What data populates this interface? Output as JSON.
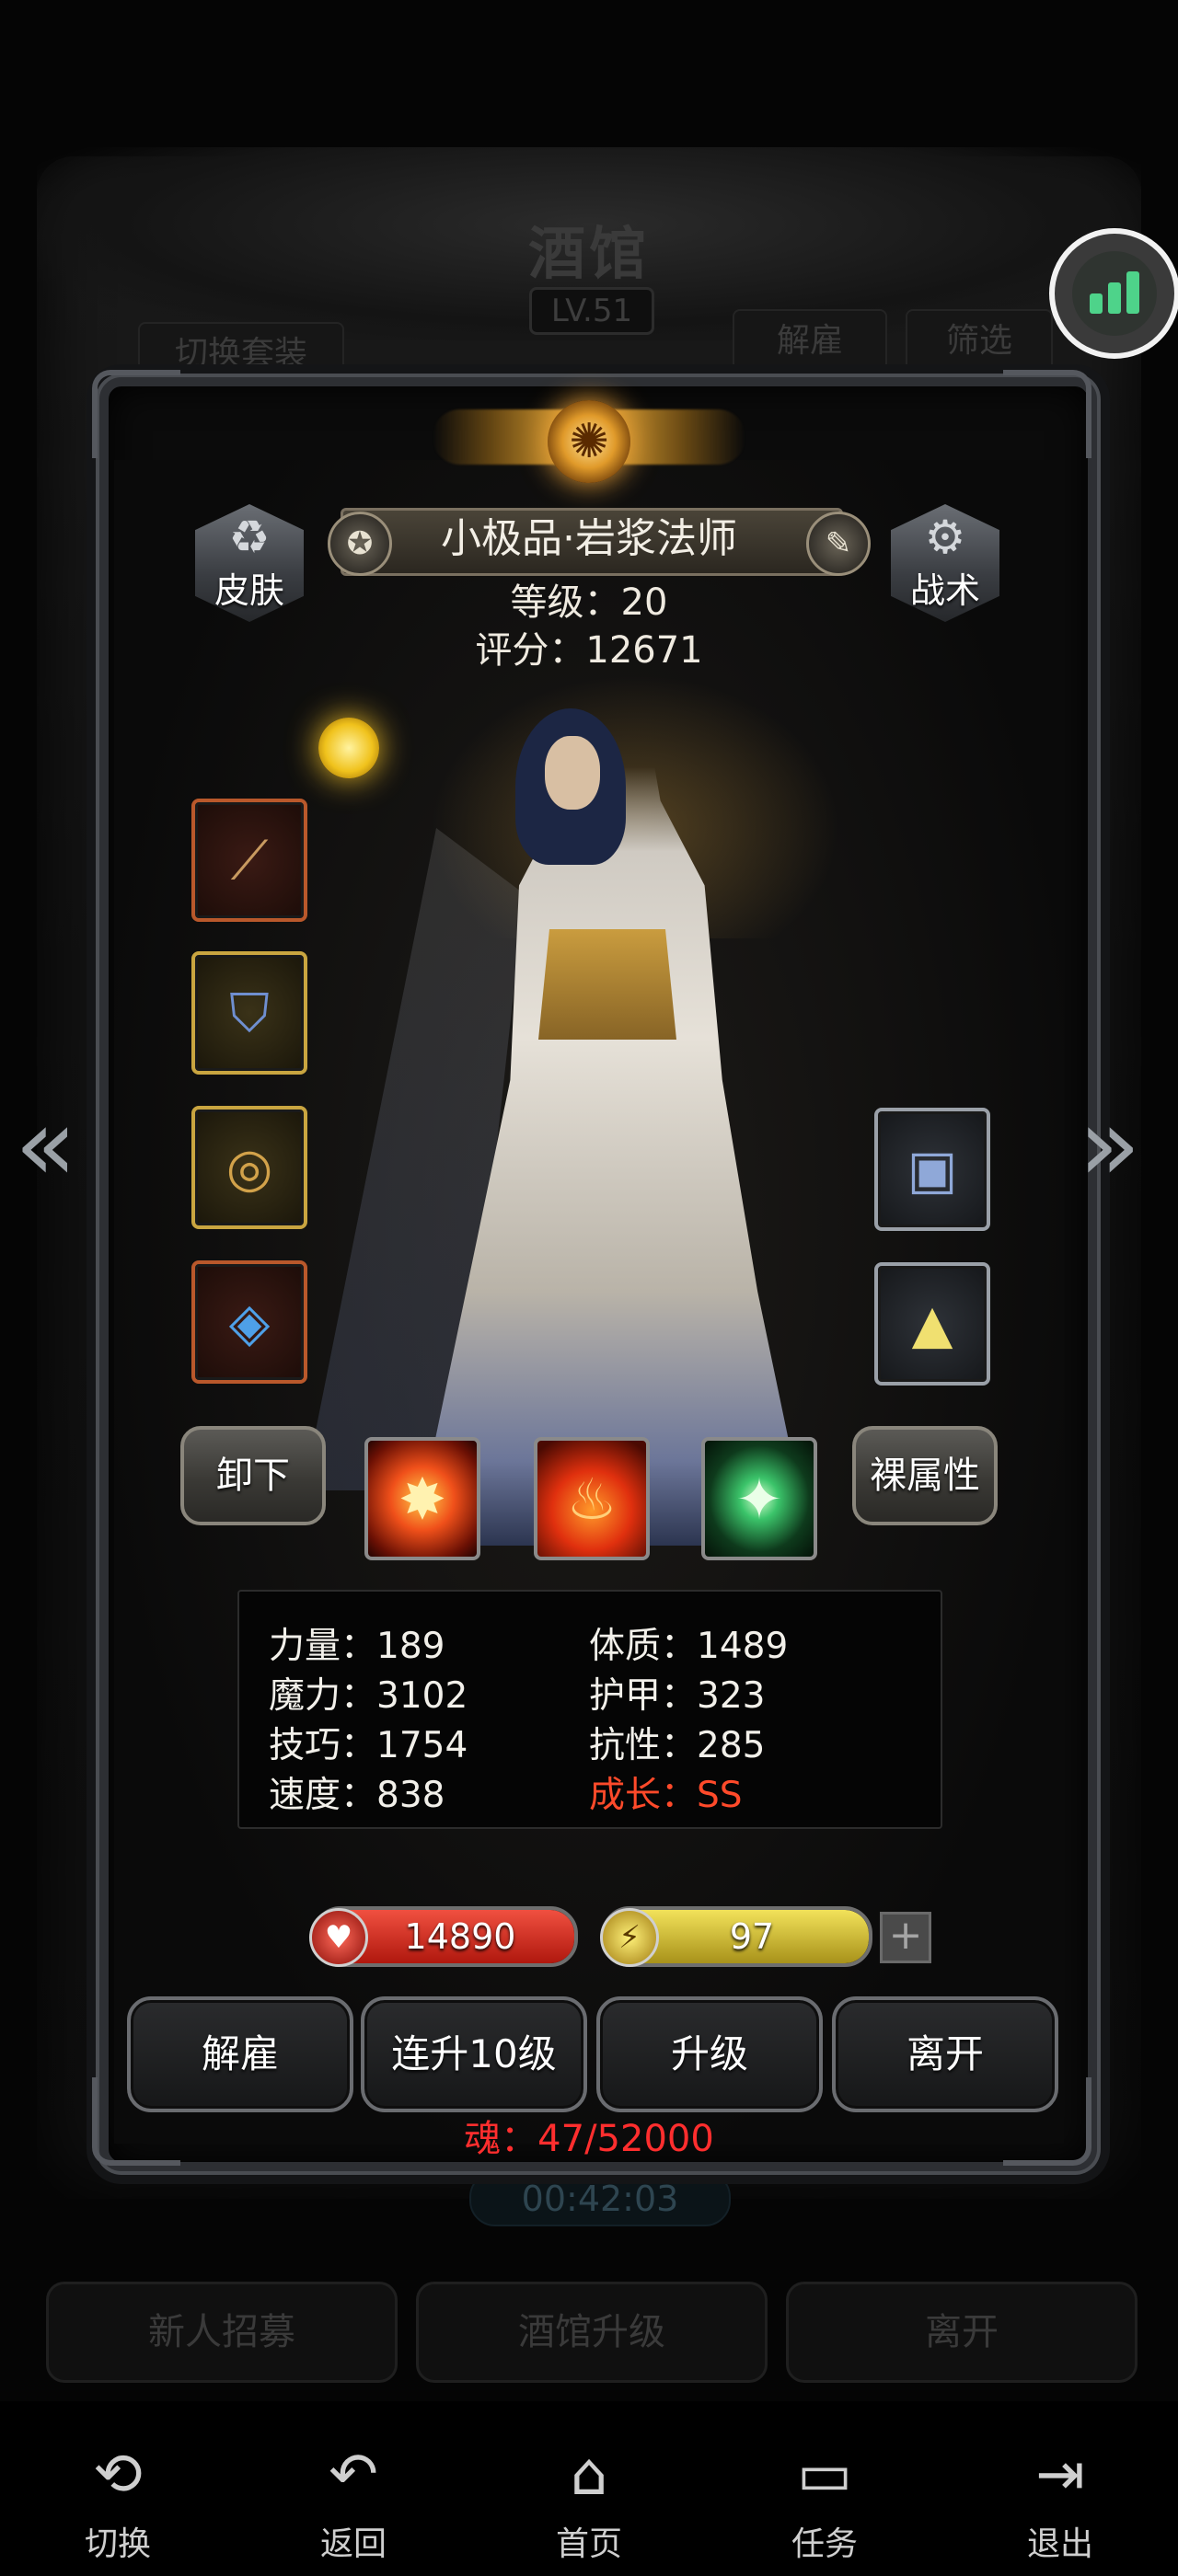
{
  "background": {
    "title": "酒馆",
    "level": "LV.51",
    "tabs": [
      "切换套装",
      "解雇",
      "筛选"
    ],
    "timer": "00:42:03",
    "buttons": [
      "新人招募",
      "酒馆升级",
      "离开"
    ]
  },
  "hero": {
    "name": "小极品·岩浆法师",
    "level_text": "等级：20",
    "score_text": "评分：12671",
    "skin_label": "皮肤",
    "tactics_label": "战术",
    "unequip_label": "卸下",
    "naked_attr_label": "裸属性"
  },
  "equipment_left": [
    {
      "icon": "staff-icon",
      "glyph": "⟋",
      "frame": "red"
    },
    {
      "icon": "robe-icon",
      "glyph": "⛉",
      "frame": "gold"
    },
    {
      "icon": "ring-icon",
      "glyph": "◎",
      "frame": "gold"
    },
    {
      "icon": "amulet-icon",
      "glyph": "◈",
      "frame": "red"
    }
  ],
  "equipment_right": [
    {
      "icon": "card-icon",
      "glyph": "▣",
      "frame": "gray"
    },
    {
      "icon": "crystal-icon",
      "glyph": "▲",
      "frame": "gray"
    }
  ],
  "skills": [
    {
      "icon": "fire-burst-icon",
      "glyph": "✸"
    },
    {
      "icon": "flame-icon",
      "glyph": "♨"
    },
    {
      "icon": "green-blade-icon",
      "glyph": "✦"
    }
  ],
  "stats": {
    "left": [
      "力量：189",
      "魔力：3102",
      "技巧：1754",
      "速度：838"
    ],
    "right": [
      "体质：1489",
      "护甲：323",
      "抗性：285",
      "成长：SS"
    ]
  },
  "bars": {
    "hp": "14890",
    "energy": "97",
    "energy_plus": "+"
  },
  "actions": [
    "解雇",
    "连升10级",
    "升级",
    "离开"
  ],
  "soul": "魂：47/52000",
  "nav": [
    {
      "label": "切换",
      "icon": "switch-icon",
      "glyph": "⟲"
    },
    {
      "label": "返回",
      "icon": "back-icon",
      "glyph": "↶"
    },
    {
      "label": "首页",
      "icon": "home-icon",
      "glyph": "⌂"
    },
    {
      "label": "任务",
      "icon": "tasks-icon",
      "glyph": "▭"
    },
    {
      "label": "退出",
      "icon": "exit-icon",
      "glyph": "⇥"
    }
  ],
  "colors": {
    "accent_gold": "#f4b23a",
    "hp_red": "#d82a1e",
    "energy_yellow": "#d8c430",
    "growth_red": "#ff4a2a",
    "soul_red": "#ff2e2e",
    "widget_green": "#4ed38a"
  }
}
